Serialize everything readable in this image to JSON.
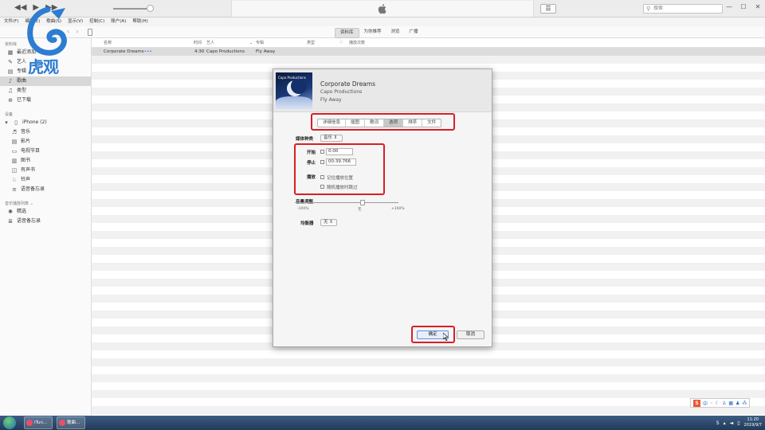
{
  "menu": [
    "文件(F)",
    "编辑(E)",
    "歌曲(S)",
    "显示(V)",
    "控制(C)",
    "账户(A)",
    "帮助(H)"
  ],
  "toolbar": {
    "search_placeholder": "搜索",
    "segments": [
      "资料库",
      "为你推荐",
      "浏览",
      "广播"
    ],
    "active_segment": "资料库"
  },
  "sidebar": {
    "library_header": "资料库",
    "library_items": [
      {
        "label": "最近添加",
        "icon": "recent-icon"
      },
      {
        "label": "艺人",
        "icon": "artist-icon"
      },
      {
        "label": "专辑",
        "icon": "album-icon"
      },
      {
        "label": "歌曲",
        "icon": "music-note-icon",
        "selected": true
      },
      {
        "label": "类型",
        "icon": "genre-icon"
      },
      {
        "label": "已下载",
        "icon": "download-icon"
      }
    ],
    "devices_header": "设备",
    "device_name": "iPhone (2)",
    "device_items": [
      {
        "label": "音乐",
        "icon": "music-note-icon"
      },
      {
        "label": "影片",
        "icon": "film-icon"
      },
      {
        "label": "电视节目",
        "icon": "tv-icon"
      },
      {
        "label": "图书",
        "icon": "book-icon"
      },
      {
        "label": "有声书",
        "icon": "audiobook-icon"
      },
      {
        "label": "铃声",
        "icon": "bell-icon"
      },
      {
        "label": "语音备忘录",
        "icon": "voice-memo-icon"
      }
    ],
    "playlists_header": "音乐播放列表 ⌄",
    "playlist_items": [
      {
        "label": "精选",
        "icon": "genius-icon"
      },
      {
        "label": "语音备忘录",
        "icon": "playlist-icon"
      }
    ]
  },
  "list": {
    "columns": [
      "名称",
      "时间",
      "艺人",
      "专辑",
      "类型",
      "♡",
      "播放次数"
    ],
    "rows": [
      {
        "name": "Corporate Dreams",
        "more": "•••",
        "time": "4:30",
        "artist": "Capo Productions",
        "album": "Fly Away"
      }
    ]
  },
  "logo": {
    "text": "虎观"
  },
  "dialog": {
    "title": "Corporate Dreams",
    "artist": "Capo Productions",
    "album": "Fly Away",
    "artwork_caption": "Capo Productions",
    "tabs": [
      "详细信息",
      "插图",
      "歌词",
      "选项",
      "排序",
      "文件"
    ],
    "active_tab": "选项",
    "media_kind_label": "媒体种类",
    "media_kind_value": "音乐",
    "start_label": "开始",
    "start_value": "0:00",
    "stop_label": "停止",
    "stop_value": "00:39.766",
    "playback_label": "播放",
    "remember_position": "记住播放位置",
    "skip_shuffle": "随机播放时跳过",
    "volume_label": "音量调整",
    "volume_min": "-100%",
    "volume_mid": "无",
    "volume_max": "+100%",
    "eq_label": "均衡器",
    "eq_value": "无",
    "ok_label": "确定",
    "cancel_label": "取消"
  },
  "taskbar": {
    "tasks": [
      "iTun...",
      "歌曲..."
    ],
    "time": "11:20",
    "date": "2019/9/7"
  }
}
